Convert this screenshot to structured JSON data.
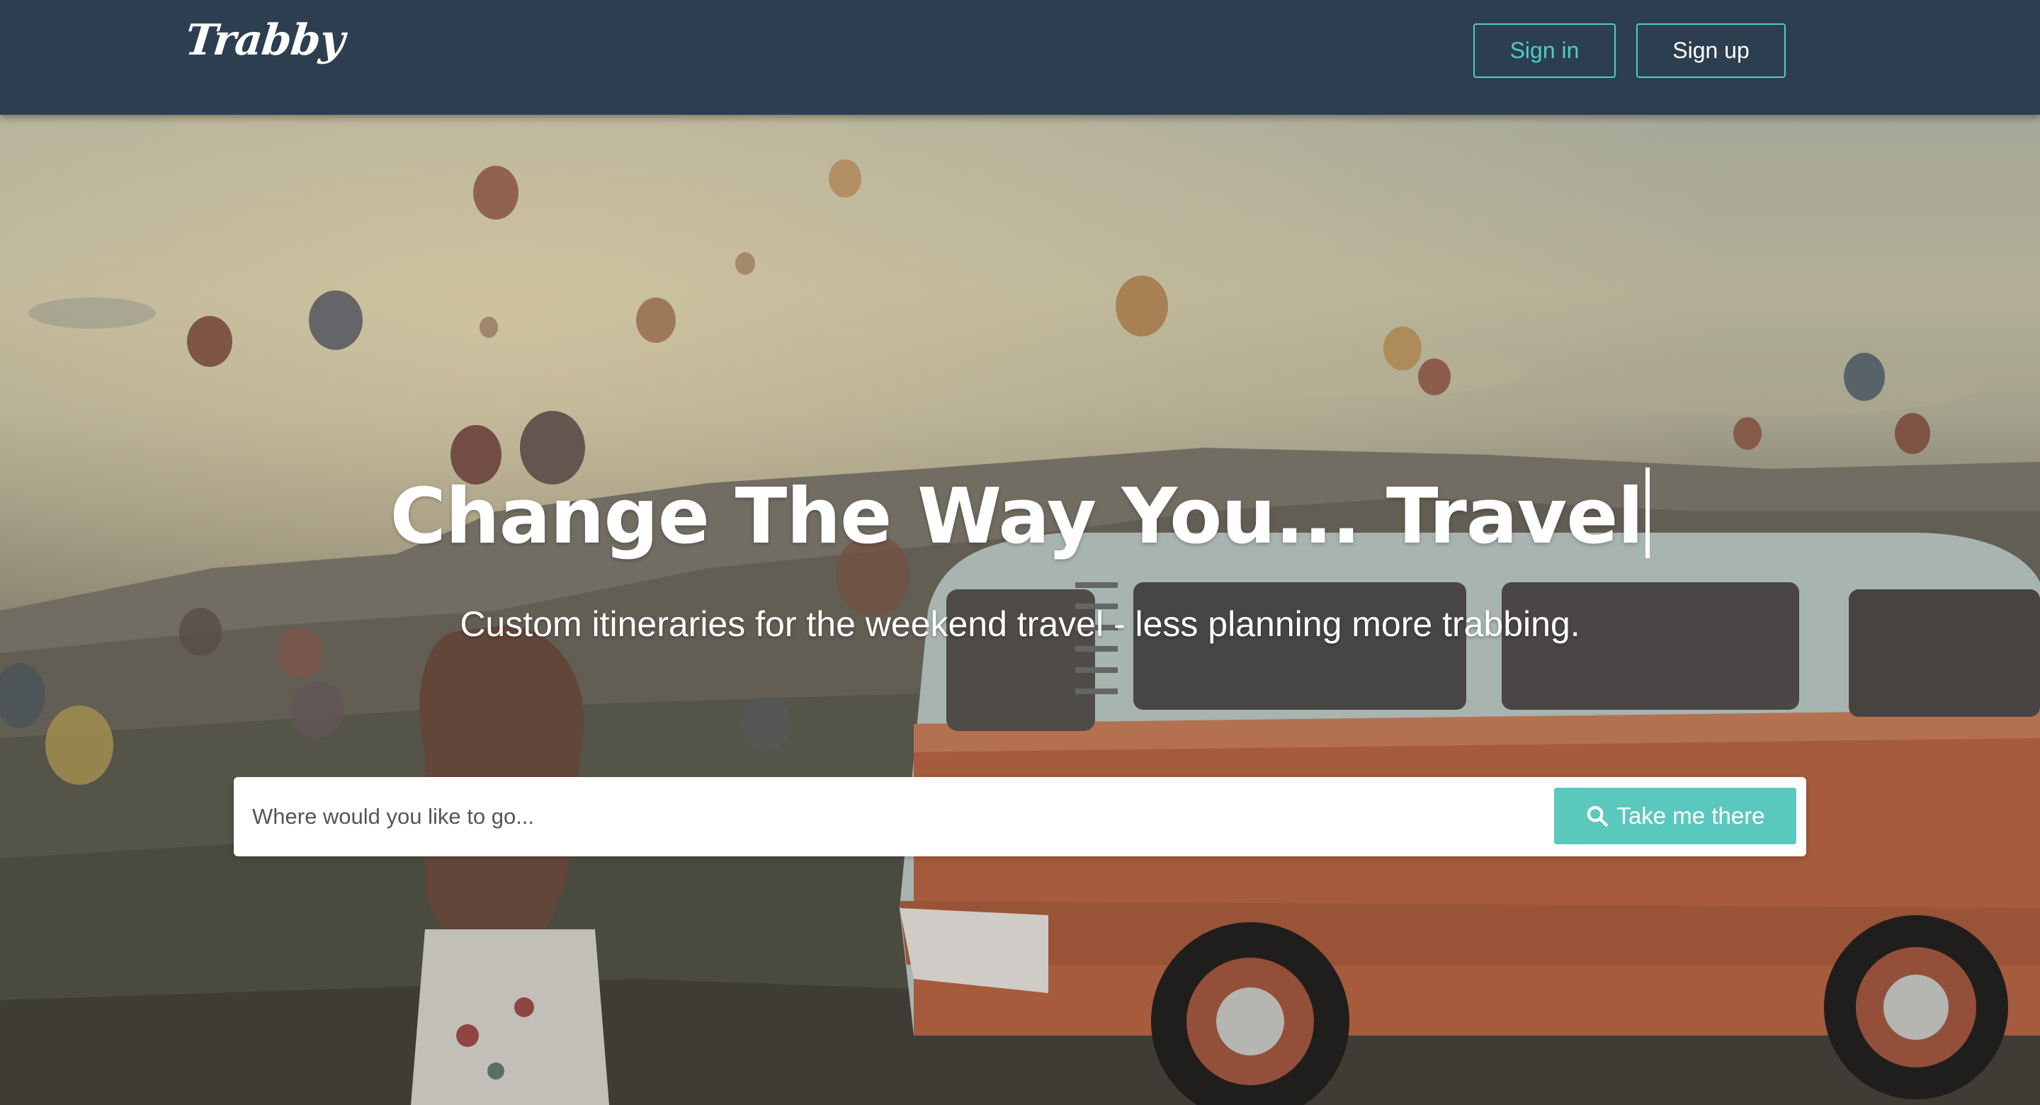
{
  "navbar": {
    "brand": "Trabby",
    "sign_in_label": "Sign in",
    "sign_up_label": "Sign up"
  },
  "hero": {
    "headline": "Change The Way You... Travel",
    "subheadline": "Custom itineraries for the weekend travel - less planning more trabbing.",
    "search": {
      "placeholder": "Where would you like to go...",
      "value": "",
      "button_label": "Take me there",
      "button_icon": "search-icon"
    }
  },
  "colors": {
    "navbar_bg": "#2d3e50",
    "accent": "#4ecdc4",
    "button_bg": "#5bc8bd",
    "text_light": "#ffffff"
  }
}
